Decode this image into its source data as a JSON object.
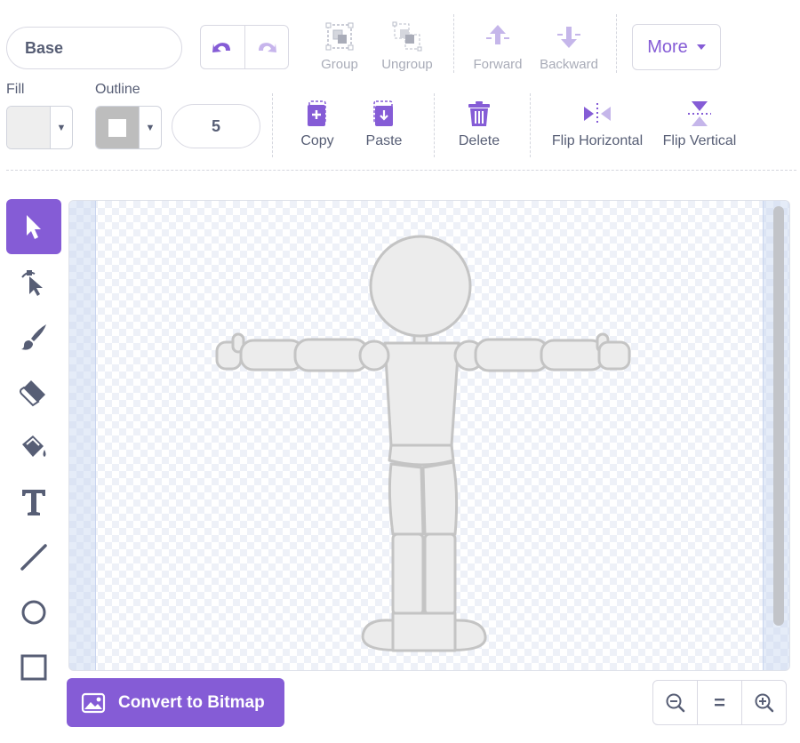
{
  "costume": {
    "name": "Base"
  },
  "toolbar": {
    "group_label": "Group",
    "ungroup_label": "Ungroup",
    "forward_label": "Forward",
    "backward_label": "Backward",
    "more_label": "More",
    "copy_label": "Copy",
    "paste_label": "Paste",
    "delete_label": "Delete",
    "flip_horizontal_label": "Flip Horizontal",
    "flip_vertical_label": "Flip Vertical"
  },
  "fill": {
    "label": "Fill",
    "color": "#eeeeee"
  },
  "outline": {
    "label": "Outline",
    "color": "#bdbdbd",
    "width": "5"
  },
  "tools": [
    "select",
    "reshape",
    "brush",
    "eraser",
    "fill",
    "text",
    "line",
    "circle",
    "rectangle"
  ],
  "active_tool": "select",
  "bottom": {
    "convert_label": "Convert to Bitmap"
  },
  "colors": {
    "accent": "#855cd6",
    "text": "#575e75",
    "disabled": "#a9acb8"
  }
}
